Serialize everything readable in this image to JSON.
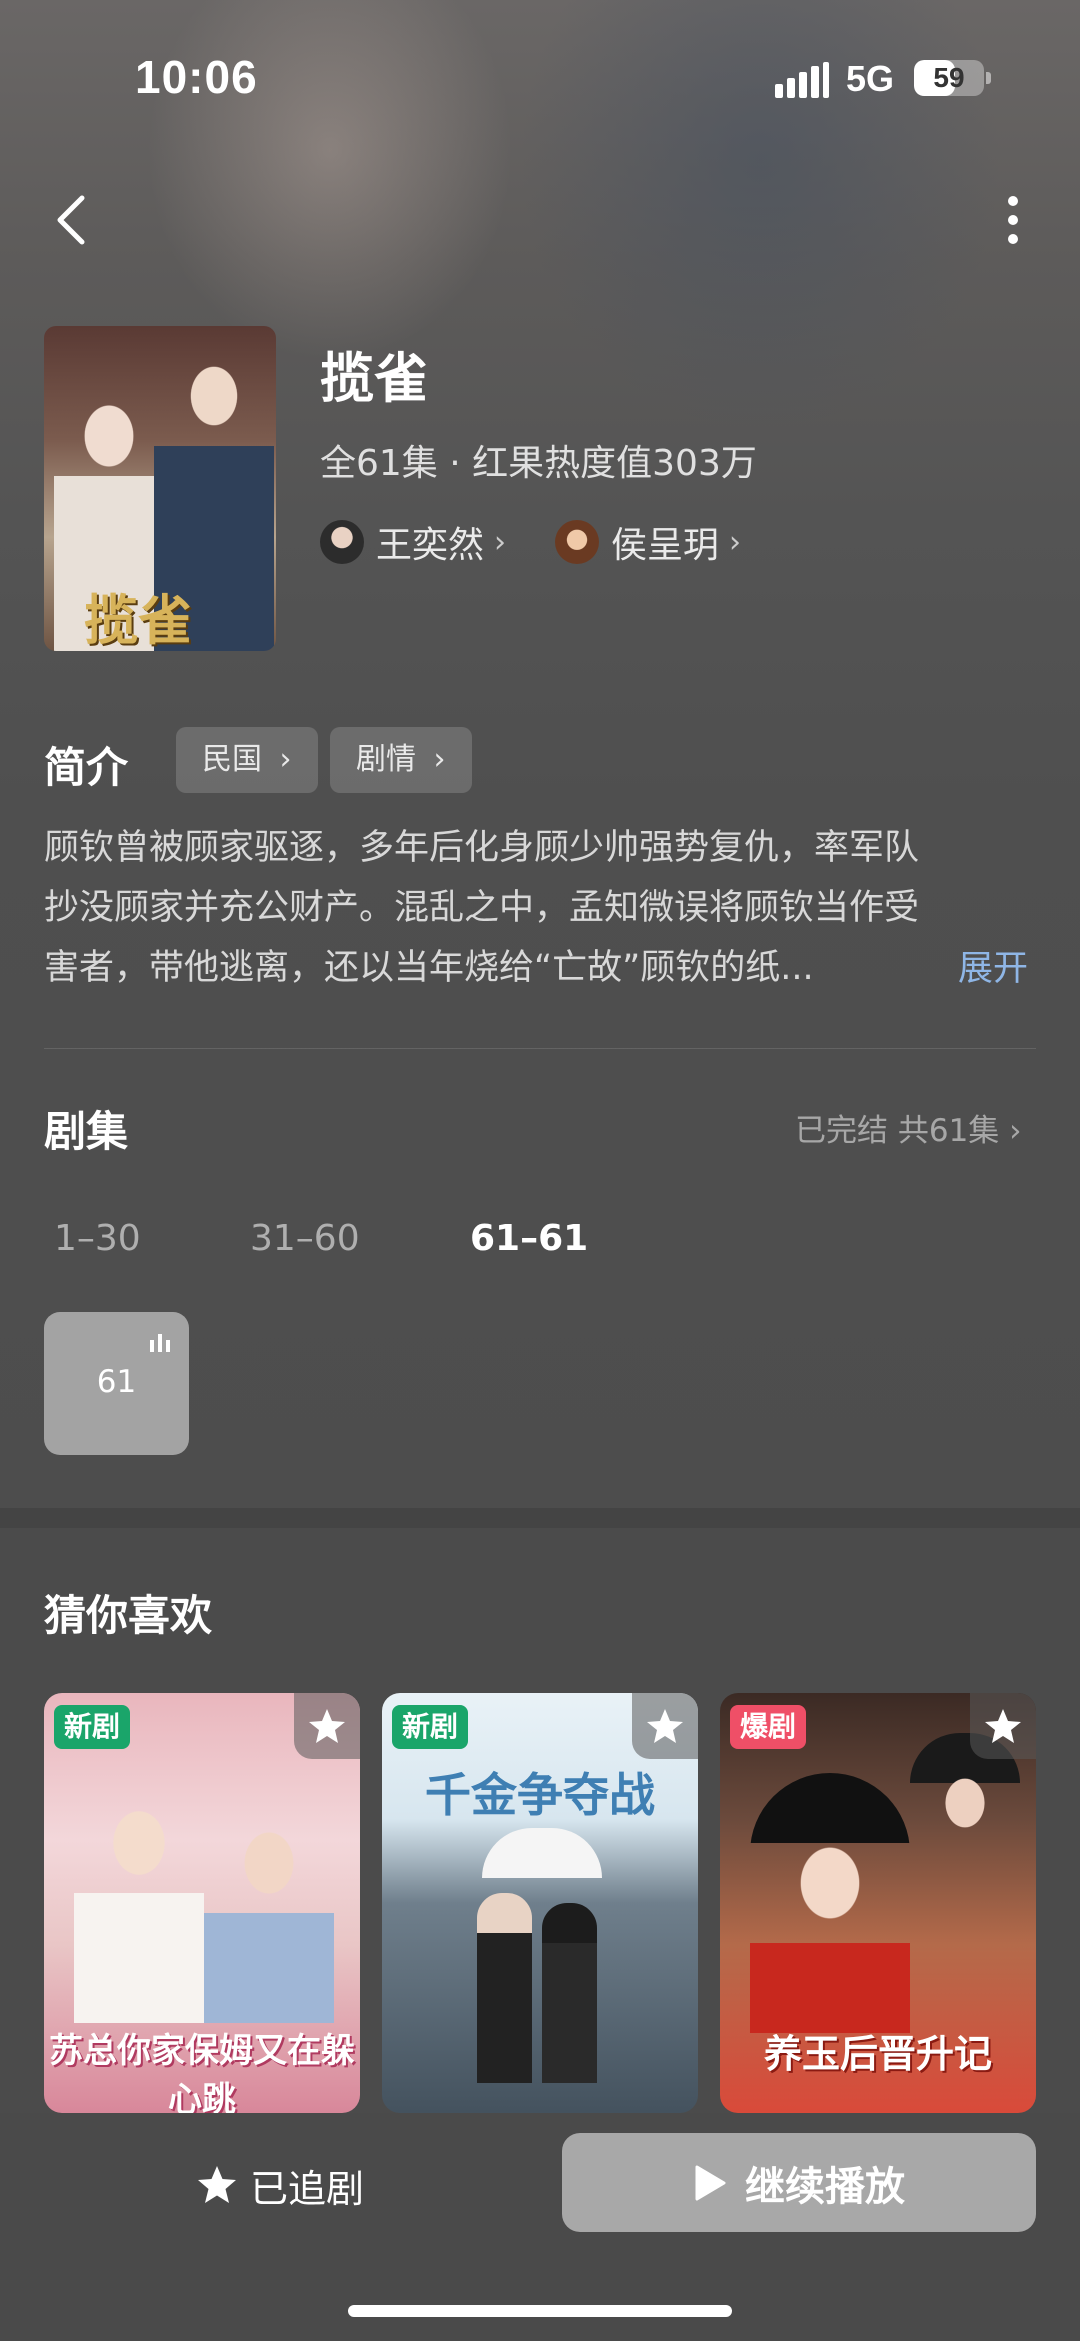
{
  "status_bar": {
    "time": "10:06",
    "network": "5G",
    "battery": "59",
    "battery_level": 0.59
  },
  "nav": {
    "back_icon": "chevron-left-icon",
    "more_icon": "more-vertical-icon"
  },
  "drama": {
    "title": "揽雀",
    "meta": "全61集 · 红果热度值303万",
    "cover_art_text": "揽雀",
    "actors": [
      {
        "name": "王奕然",
        "chevron": "›"
      },
      {
        "name": "侯呈玥",
        "chevron": "›"
      }
    ]
  },
  "synopsis": {
    "title": "简介",
    "tags": [
      {
        "label": "民国",
        "chevron": "›"
      },
      {
        "label": "剧情",
        "chevron": "›"
      }
    ],
    "lines": [
      "顾钦曾被顾家驱逐，多年后化身顾少帅强势复仇，率军队",
      "抄没顾家并充公财产。混乱之中，孟知微误将顾钦当作受",
      "害者，带他逃离，还以当年烧给“亡故”顾钦的纸..."
    ],
    "expand_label": "展开"
  },
  "episodes": {
    "title": "剧集",
    "status": "已完结 共61集 ›",
    "ranges": [
      {
        "label": "1–30",
        "active": false
      },
      {
        "label": "31–60",
        "active": false
      },
      {
        "label": "61–61",
        "active": true
      }
    ],
    "tiles": [
      {
        "number": "61",
        "playing_icon": "playing-bars-icon"
      }
    ]
  },
  "recommendations": {
    "title": "猜你喜欢",
    "items": [
      {
        "badge": "新剧",
        "badge_color": "#1aa56a",
        "art_text": "苏总你家保姆又在躲心跳",
        "star_icon": "star-icon"
      },
      {
        "badge": "新剧",
        "badge_color": "#1aa56a",
        "art_text": "千金争夺战",
        "star_icon": "star-icon"
      },
      {
        "badge": "爆剧",
        "badge_color": "#ef4f67",
        "art_text": "养玉后晋升记",
        "star_icon": "star-icon"
      }
    ]
  },
  "bottom_bar": {
    "follow_label": "已追剧",
    "follow_icon": "star-icon",
    "play_label": "继续播放",
    "play_icon": "play-icon"
  }
}
